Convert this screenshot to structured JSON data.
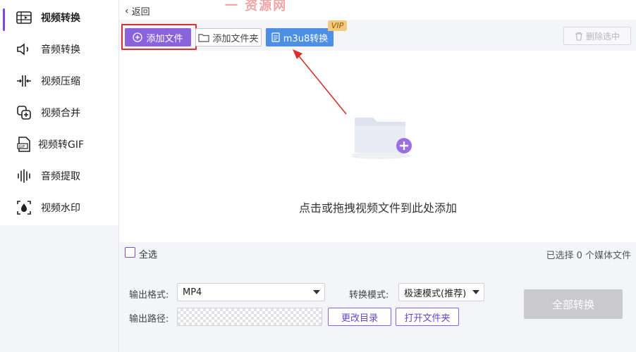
{
  "sidebar": {
    "items": [
      {
        "label": "视频转换",
        "icon": "video-convert-icon"
      },
      {
        "label": "音频转换",
        "icon": "audio-convert-icon"
      },
      {
        "label": "视频压缩",
        "icon": "compress-icon"
      },
      {
        "label": "视频合并",
        "icon": "merge-icon"
      },
      {
        "label": "视频转GIF",
        "icon": "gif-icon"
      },
      {
        "label": "音频提取",
        "icon": "audio-extract-icon"
      },
      {
        "label": "视频水印",
        "icon": "watermark-icon"
      }
    ]
  },
  "header": {
    "back_label": "返回",
    "watermark_text": "一 资源网"
  },
  "toolbar": {
    "add_file_label": "添加文件",
    "add_folder_label": "添加文件夹",
    "m3u8_label": "m3u8转换",
    "vip_badge": "VIP",
    "delete_label": "删除选中"
  },
  "dropzone": {
    "hint": "点击或拖拽视频文件到此处添加"
  },
  "selection": {
    "select_all_label": "全选",
    "count_text": "已选择 0 个媒体文件"
  },
  "output": {
    "format_label": "输出格式:",
    "format_value": "MP4",
    "mode_label": "转换模式:",
    "mode_value": "极速模式(推荐)",
    "path_label": "输出路径:",
    "change_dir_label": "更改目录",
    "open_folder_label": "打开文件夹",
    "convert_all_label": "全部转换"
  },
  "colors": {
    "accent": "#8a63dc",
    "blue": "#4e8fe6",
    "highlight": "#d9312f",
    "disabled": "#c9c9ce"
  }
}
